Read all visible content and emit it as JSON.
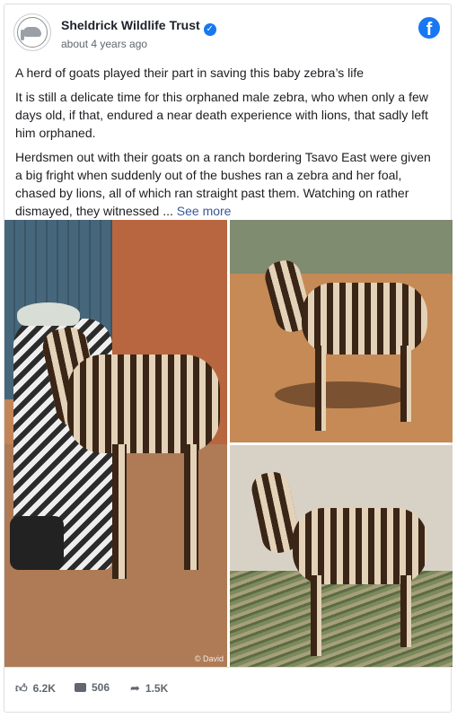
{
  "header": {
    "page_name": "Sheldrick Wildlife Trust",
    "verified_mark": "✓",
    "timestamp": "about 4 years ago",
    "brand_icon": "facebook-icon",
    "brand_letter": "f"
  },
  "post": {
    "title": "A herd of goats played their part in saving this baby zebra’s life",
    "paragraph_1": "It is still a delicate time for this orphaned male zebra, who when only a few days old, if that, endured a near death experience with lions, that sadly left him orphaned.",
    "paragraph_2": "Herdsmen out with their goats on a ranch bordering Tsavo East were given a big fright when suddenly out of the bushes ran a zebra and her foal, chased by lions, all of which ran straight past them. Watching on rather dismayed, they witnessed ... ",
    "see_more": "See more"
  },
  "photos": {
    "watermark": "© David"
  },
  "stats": {
    "likes": "6.2K",
    "comments": "506",
    "shares": "1.5K",
    "like_icon": "thumbs-up-icon",
    "comment_icon": "comment-icon",
    "share_icon": "share-icon"
  },
  "colors": {
    "brand": "#1877f2",
    "link": "#385898",
    "secondary_text": "#606770"
  }
}
